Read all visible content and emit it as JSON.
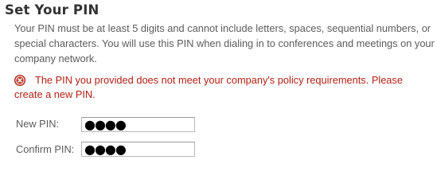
{
  "heading": {
    "title": "Set Your PIN"
  },
  "instructions": {
    "text": "Your PIN must be at least 5 digits and cannot include letters, spaces, sequential numbers, or special characters. You will use this PIN when dialing in to conferences and meetings on your company network."
  },
  "error": {
    "icon": "error-circle-x-icon",
    "line1": "The PIN you provided does not meet your company's policy requirements. Please",
    "line2": "create a new PIN.",
    "color": "#b01f12"
  },
  "form": {
    "new_pin": {
      "label": "New PIN:",
      "value": "●●●●"
    },
    "confirm_pin": {
      "label": "Confirm PIN:",
      "value": "●●●●"
    }
  }
}
